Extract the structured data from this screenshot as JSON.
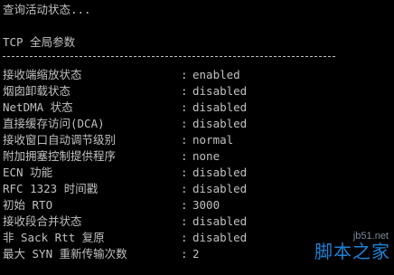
{
  "console": {
    "status_line": "查询活动状态...",
    "section_title": "TCP 全局参数",
    "separator": "----------------------------------------------",
    "rows": [
      {
        "key": "接收端缩放状态",
        "value": "enabled"
      },
      {
        "key": "烟囱卸载状态",
        "value": "disabled"
      },
      {
        "key": "NetDMA 状态",
        "value": "disabled"
      },
      {
        "key": "直接缓存访问(DCA)",
        "value": "disabled"
      },
      {
        "key": "接收窗口自动调节级别",
        "value": "normal"
      },
      {
        "key": "附加拥塞控制提供程序",
        "value": "none"
      },
      {
        "key": "ECN 功能",
        "value": "disabled"
      },
      {
        "key": "RFC 1323 时间戳",
        "value": "disabled"
      },
      {
        "key": "初始 RTO",
        "value": "3000"
      },
      {
        "key": "接收段合并状态",
        "value": "disabled"
      },
      {
        "key": "非 Sack Rtt 复原",
        "value": "disabled"
      },
      {
        "key": "最大 SYN 重新传输次数",
        "value": "2"
      }
    ],
    "colon": ":"
  },
  "watermark": {
    "url": "jb51.net",
    "brand": "脚本之家"
  },
  "colors": {
    "background": "#000000",
    "text": "#c0c0c0",
    "brand": "#1f82d6"
  }
}
